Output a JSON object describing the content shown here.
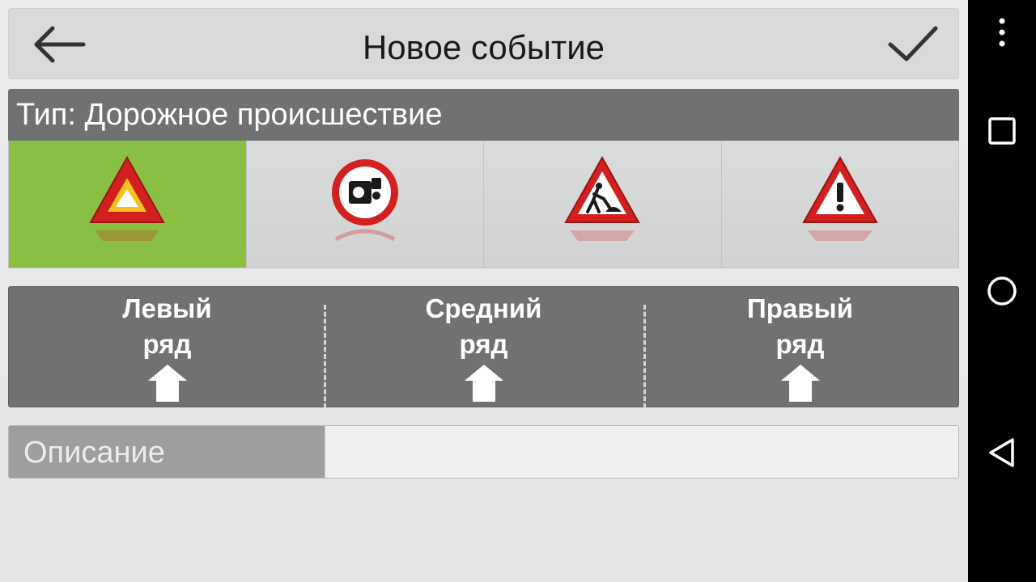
{
  "header": {
    "title": "Новое событие",
    "back_icon": "back-arrow-icon",
    "confirm_icon": "checkmark-icon"
  },
  "event_type": {
    "label": "Тип: Дорожное происшествие",
    "options": [
      {
        "name": "accident",
        "icon": "warning-triangle-icon",
        "selected": true
      },
      {
        "name": "speed-camera",
        "icon": "speed-camera-icon",
        "selected": false
      },
      {
        "name": "road-works",
        "icon": "road-works-icon",
        "selected": false
      },
      {
        "name": "danger",
        "icon": "exclamation-triangle-icon",
        "selected": false
      }
    ],
    "selected_color": "#8ac041"
  },
  "lanes": [
    {
      "line1": "Левый",
      "line2": "ряд"
    },
    {
      "line1": "Средний",
      "line2": "ряд"
    },
    {
      "line1": "Правый",
      "line2": "ряд"
    }
  ],
  "description": {
    "label": "Описание",
    "value": ""
  },
  "system_nav": {
    "menu_icon": "overflow-menu-icon",
    "recents_icon": "recents-square-icon",
    "home_icon": "home-circle-icon",
    "back_icon": "back-triangle-icon"
  }
}
